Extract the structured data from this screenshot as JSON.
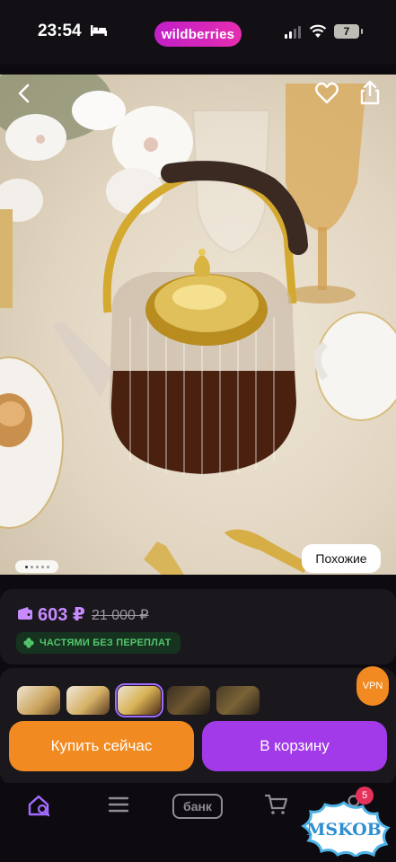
{
  "status_bar": {
    "time": "23:54",
    "battery": "7",
    "brand": "wildberries"
  },
  "product": {
    "similar_label": "Похожие",
    "price": "603 ₽",
    "old_price": "21 000 ₽",
    "installment_label": "ЧАСТЯМИ БЕЗ ПЕРЕПЛАТ",
    "thumbnail_count": 5,
    "selected_thumbnail": 3
  },
  "actions": {
    "buy_now": "Купить сейчас",
    "add_to_cart": "В корзину"
  },
  "floating": {
    "vpn": "VPN"
  },
  "bottom_nav": {
    "bank": "банк",
    "cart_badge": "5"
  },
  "watermark": "MSKOB",
  "colors": {
    "brand": "#cb24c2",
    "price": "#c88bff",
    "buy": "#f28a22",
    "cart": "#a23ae9",
    "installment": "#52c66d"
  }
}
